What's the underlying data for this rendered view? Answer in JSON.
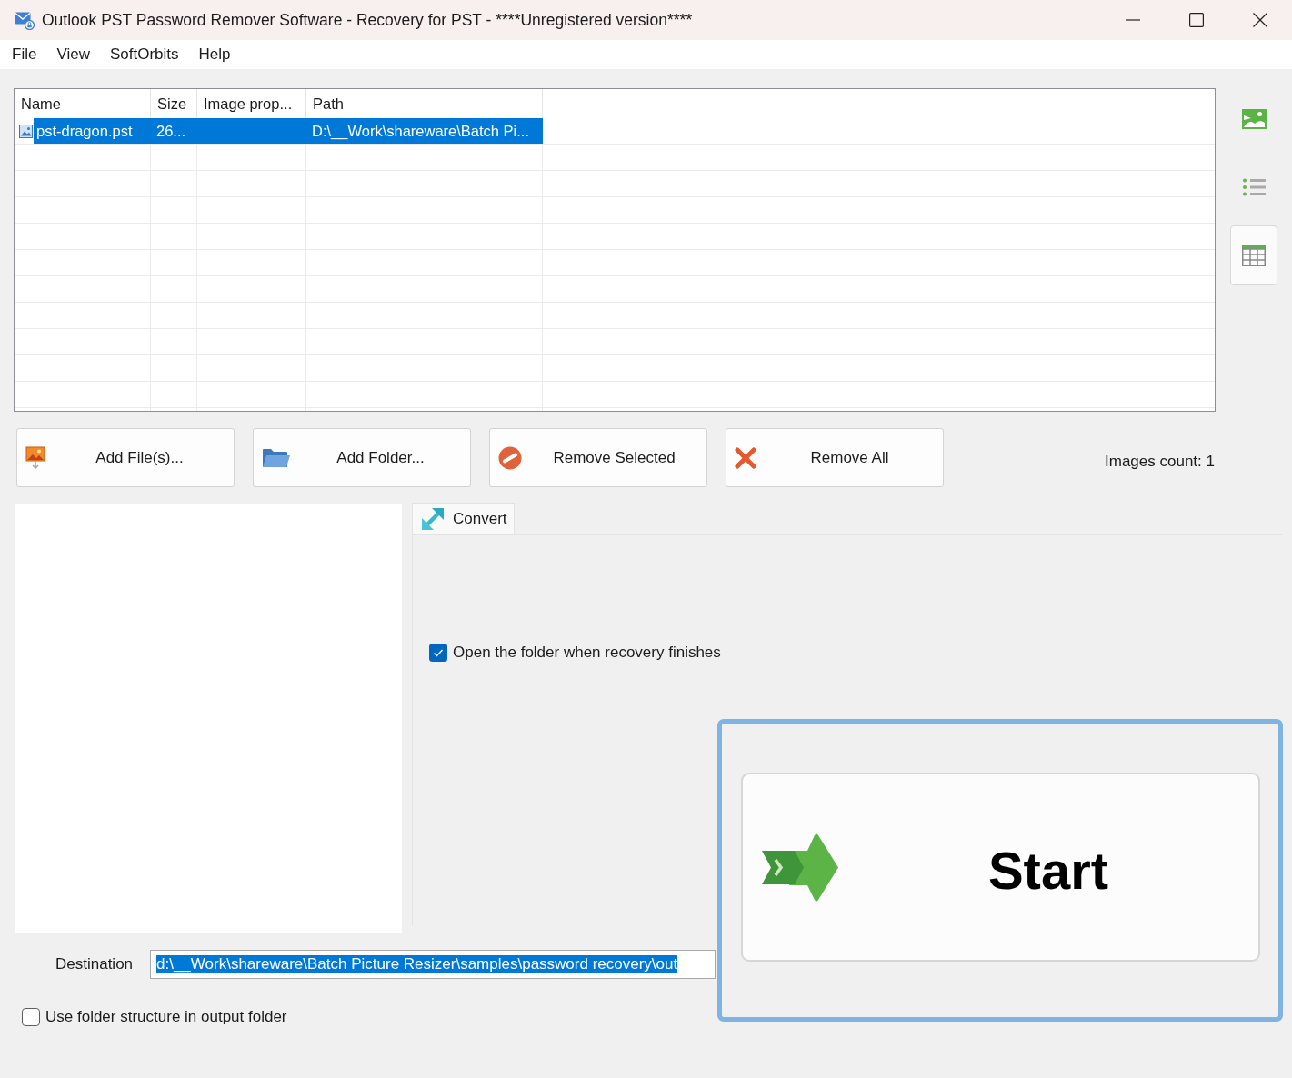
{
  "window": {
    "title": "Outlook PST Password Remover Software - Recovery for PST - ****Unregistered version****"
  },
  "menu": [
    {
      "label": "File"
    },
    {
      "label": "View"
    },
    {
      "label": "SoftOrbits"
    },
    {
      "label": "Help"
    }
  ],
  "file_list": {
    "columns": [
      "Name",
      "Size",
      "Image prop...",
      "Path"
    ],
    "rows": [
      {
        "cells": [
          "pst-dragon.pst",
          "26...",
          null,
          "D:\\__Work\\shareware\\Batch Pi..."
        ],
        "selected": true
      }
    ]
  },
  "view_buttons": [
    {
      "kind": "thumbnails",
      "selected": false
    },
    {
      "kind": "list",
      "selected": false
    },
    {
      "kind": "table",
      "selected": true
    }
  ],
  "actions": [
    {
      "kind": "add_files",
      "label": "Add File(s)..."
    },
    {
      "kind": "add_folder",
      "label": "Add Folder..."
    },
    {
      "kind": "remove_selected",
      "label": "Remove Selected"
    },
    {
      "kind": "remove_all",
      "label": "Remove All"
    }
  ],
  "images_count": "Images count: 1",
  "tabs": [
    {
      "label": "Convert",
      "selected": true
    }
  ],
  "convert_options": [
    {
      "label": "Open the folder when recovery finishes",
      "checked": true
    }
  ],
  "destination": {
    "label": "Destination",
    "value": "d:\\__Work\\shareware\\Batch Picture Resizer\\samples\\password recovery\\out",
    "text_selected": true
  },
  "folder_structure": {
    "label": "Use folder structure in output folder",
    "checked": false
  },
  "start_button": {
    "label": "Start",
    "highlighted": true
  }
}
